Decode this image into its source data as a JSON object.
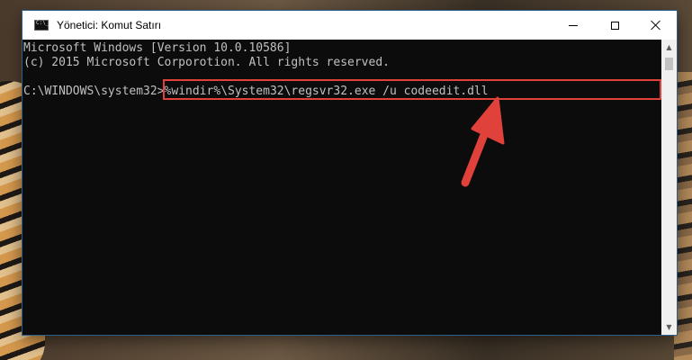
{
  "window": {
    "title": "Yönetici: Komut Satırı",
    "buttons": {
      "minimize_icon": "minimize-icon",
      "maximize_icon": "maximize-icon",
      "close_icon": "close-icon"
    }
  },
  "console": {
    "lines": [
      "Microsoft Windows [Version 10.0.10586]",
      "(c) 2015 Microsoft Corporotion. All rights reserved."
    ],
    "prompt": "C:\\WINDOWS\\system32>",
    "command": "%windir%\\System32\\regsvr32.exe /u codeedit.dll"
  },
  "annotation": {
    "highlight_color": "#e0423b",
    "arrow_color": "#e0423b"
  },
  "scrollbar": {
    "up_icon": "scroll-up-arrow-icon",
    "down_icon": "scroll-down-arrow-icon"
  }
}
